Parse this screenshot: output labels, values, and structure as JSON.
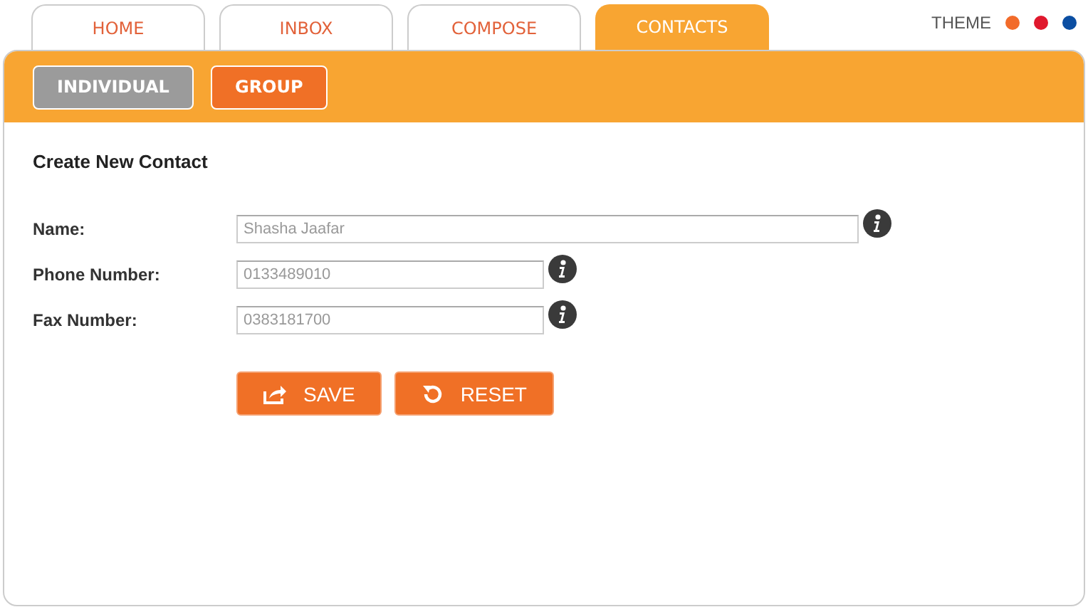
{
  "tabs": [
    {
      "label": "HOME",
      "selected": false
    },
    {
      "label": "INBOX",
      "selected": false
    },
    {
      "label": "COMPOSE",
      "selected": false
    },
    {
      "label": "CONTACTS",
      "selected": true
    }
  ],
  "theme": {
    "label": "THEME",
    "options": [
      {
        "color": "#f26b2a"
      },
      {
        "color": "#e0182d"
      },
      {
        "color": "#0b4ea2"
      }
    ]
  },
  "subtabs": [
    {
      "label": "INDIVIDUAL",
      "selected": true
    },
    {
      "label": "GROUP",
      "selected": false
    }
  ],
  "form": {
    "title": "Create New Contact",
    "fields": [
      {
        "label": "Name:",
        "value": "Shasha Jaafar",
        "wide": true
      },
      {
        "label": "Phone Number:",
        "value": "0133489010",
        "wide": false
      },
      {
        "label": "Fax Number:",
        "value": "0383181700",
        "wide": false
      }
    ],
    "buttons": [
      {
        "label": "SAVE",
        "kind": "save"
      },
      {
        "label": "RESET",
        "kind": "reset"
      }
    ]
  }
}
